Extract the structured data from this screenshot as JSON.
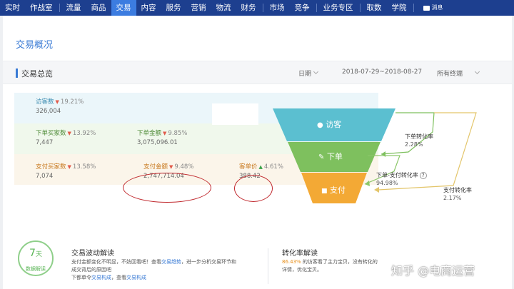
{
  "nav": {
    "items": [
      {
        "label": "实时",
        "active": false
      },
      {
        "label": "作战室",
        "active": false
      },
      {
        "label": "流量",
        "active": false
      },
      {
        "label": "商品",
        "active": false
      },
      {
        "label": "交易",
        "active": true
      },
      {
        "label": "内容",
        "active": false
      },
      {
        "label": "服务",
        "active": false
      },
      {
        "label": "营销",
        "active": false
      },
      {
        "label": "物流",
        "active": false
      },
      {
        "label": "财务",
        "active": false
      },
      {
        "label": "市场",
        "active": false
      },
      {
        "label": "竞争",
        "active": false
      },
      {
        "label": "业务专区",
        "active": false
      },
      {
        "label": "取数",
        "active": false
      },
      {
        "label": "学院",
        "active": false
      }
    ],
    "message_label": "消息",
    "active_color": "#3c7ce0",
    "bar_color": "#1d3f8f"
  },
  "page": {
    "title": "交易概况",
    "overview_label": "交易总览",
    "date_label": "日期",
    "date_range": "2018-07-29~2018-08-27",
    "terminal_label": "所有终端"
  },
  "metrics": {
    "visitors": {
      "name": "访客数",
      "change": "19.21%",
      "value": "326,004",
      "trend": "down"
    },
    "order_buyers": {
      "name": "下单买家数",
      "change": "13.92%",
      "value": "7,447",
      "trend": "down"
    },
    "order_amount": {
      "name": "下单金额",
      "change": "9.85%",
      "value": "3,075,096.01",
      "trend": "down"
    },
    "pay_buyers": {
      "name": "支付买家数",
      "change": "13.58%",
      "value": "7,074",
      "trend": "down"
    },
    "pay_amount": {
      "name": "支付金额",
      "change": "9.48%",
      "value": "2,747,714.04",
      "trend": "down"
    },
    "unit_price": {
      "name": "客单价",
      "change": "4.61%",
      "value": "388.42",
      "trend": "up"
    }
  },
  "funnel": {
    "visitor_label": "访客",
    "order_label": "下单",
    "pay_label": "支付",
    "colors": {
      "visitor": "#5bbfd0",
      "order": "#7ec05e",
      "pay": "#f3a935"
    }
  },
  "rates": {
    "order_rate": {
      "label": "下单转化率",
      "value": "2.28%"
    },
    "order_pay_rate": {
      "label": "下单-支付转化率",
      "value": "94.98%"
    },
    "pay_rate": {
      "label": "支付转化率",
      "value": "2.17%"
    }
  },
  "bottom": {
    "badge_days": "7",
    "badge_unit": "天",
    "badge_caption": "数据解读",
    "card1": {
      "title": "交易波动解读",
      "line1_a": "支付金额变化不明显，不妨回看吧！查看",
      "line1_link": "交易趋势",
      "line1_b": "，进一步分析交易环节和",
      "line2": "成交背后的原因吧",
      "line3_a": "下都单令",
      "line3_link1": "交易构成",
      "line3_b": "，查看",
      "line3_link2": "交易构成"
    },
    "card2": {
      "title": "转化率解读",
      "line1_val": "86.43%",
      "line1_text": "的访客看了主力宝贝，没有转化的",
      "line2": "详情，优化宝贝。"
    }
  },
  "watermark": "知乎 @电商运营"
}
